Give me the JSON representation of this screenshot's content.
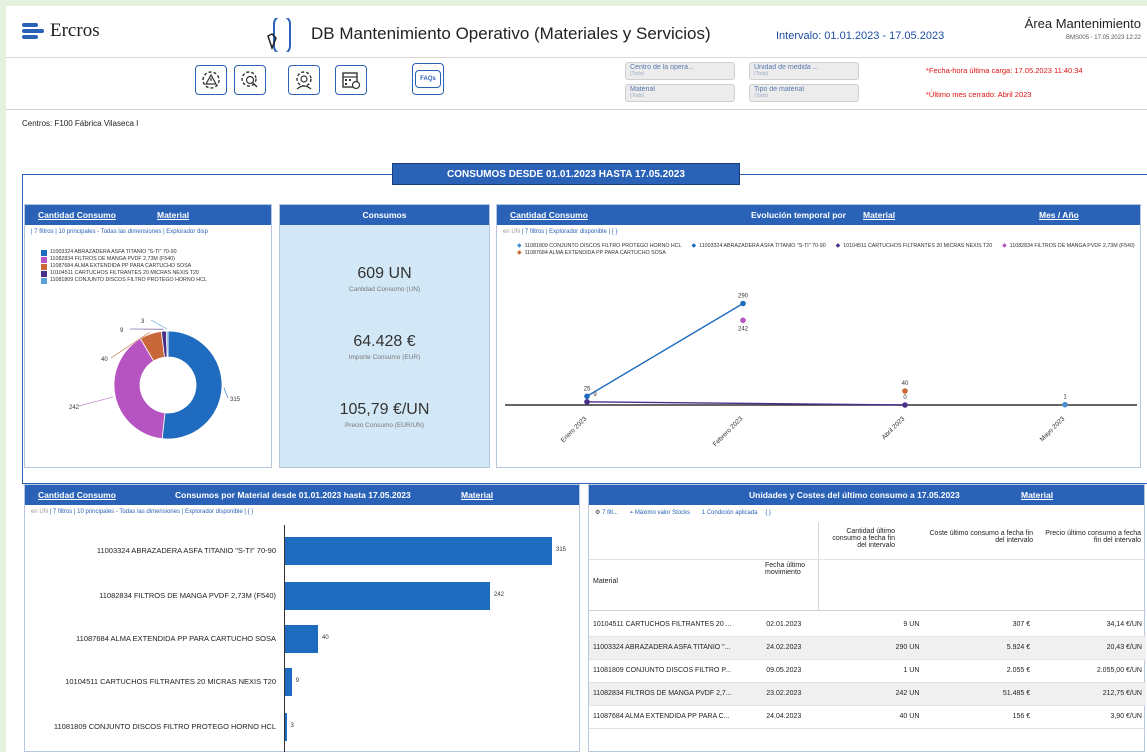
{
  "header": {
    "logo_text": "Ercros",
    "title": "DB Mantenimiento Operativo (Materiales y Servicios)",
    "interval": "Intervalo: 01.01.2023 - 17.05.2023",
    "area_title": "Área Mantenimiento",
    "area_sub": "BMS005 ⋅ 17.05.2023 12:22"
  },
  "toolbar": {
    "buttons": [
      "settings-alert-icon",
      "settings-search-icon",
      "time-gear-icon",
      "calendar-gear-icon"
    ],
    "faq_label": "FAQs"
  },
  "filters": [
    {
      "label": "Centro de la opera...",
      "value": "(Todo)"
    },
    {
      "label": "Unidad de medida ...",
      "value": "(Todo)"
    },
    {
      "label": "Material",
      "value": "(Todo)"
    },
    {
      "label": "Tipo de material",
      "value": "(Todo)"
    }
  ],
  "notes": {
    "last_load": "*Fecha-hora última carga: 17.05.2023 11:40:34",
    "last_month": "*Último mes cerrado:  Abril 2023"
  },
  "centers": "Centros: F100 Fábrica Vilaseca I",
  "banner": "CONSUMOS DESDE 01.01.2023 HASTA 17.05.2023",
  "donut_card": {
    "head_left": "Cantidad Consumo",
    "head_right": "Material",
    "subbar": "| 7 filtros | 10 principales - Todas las dimensiones | Explorador disp",
    "chart_data": {
      "type": "pie",
      "slices": [
        {
          "name": "11003324 ABRAZADERA ASFA TITANIO \"S-TI\" 70-90",
          "value": 315,
          "color": "#1f6bbf"
        },
        {
          "name": "11082834 FILTROS DE MANGA PVDF 2,73M (F540)",
          "value": 242,
          "color": "#b655c2"
        },
        {
          "name": "11087684 ALMA EXTENDIDA PP PARA CARTUCHO SOSA",
          "value": 40,
          "color": "#c8683a"
        },
        {
          "name": "10104511 CARTUCHOS FILTRANTES 20 MICRAS NEXIS T20",
          "value": 9,
          "color": "#4a2f8a"
        },
        {
          "name": "11081809 CONJUNTO DISCOS FILTRO PROTEGO HORNO HCL",
          "value": 3,
          "color": "#5aa0d8"
        }
      ],
      "labels": [
        "315",
        "242",
        "40",
        "9",
        "3"
      ]
    }
  },
  "kpi_card": {
    "head": "Consumos",
    "items": [
      {
        "value": "609 UN",
        "label": "Cantidad Consumo (UN)"
      },
      {
        "value": "64.428 €",
        "label": "Importe Consumo (EUR)"
      },
      {
        "value": "105,79 €/UN",
        "label": "Precio Consumo (EUR/UN)"
      }
    ]
  },
  "line_card": {
    "head_left": "Cantidad Consumo",
    "head_mid": "Evolución temporal por",
    "head_mid_link": "Material",
    "head_right": "Mes / Año",
    "subbar_grey": "en UN",
    "subbar": "| 7 filtros | Explorador disponible | { }",
    "chart_data": {
      "type": "line",
      "categories": [
        "Enero 2023",
        "Febrero 2023",
        "Abril 2023",
        "Mayo 2023"
      ],
      "series": [
        {
          "name": "11081809 CONJUNTO DISCOS FILTRO PROTEGO HORNO HCL",
          "color": "#4a8fd0",
          "values": [
            null,
            null,
            null,
            1
          ]
        },
        {
          "name": "11003324 ABRAZADERA ASFA TITANIO \"S-TI\" 70-90",
          "color": "#1f6bbf",
          "values": [
            25,
            290,
            null,
            null
          ]
        },
        {
          "name": "10104511 CARTUCHOS FILTRANTES 20 MICRAS NEXIS T20",
          "color": "#4a2f8a",
          "values": [
            9,
            null,
            0,
            null
          ]
        },
        {
          "name": "11082834 FILTROS DE MANGA PVDF 2,73M (F540)",
          "color": "#b655c2",
          "values": [
            null,
            242,
            null,
            null
          ]
        },
        {
          "name": "11087684 ALMA EXTENDIDA PP PARA CARTUCHO SOSA",
          "color": "#c8683a",
          "values": [
            null,
            null,
            40,
            null
          ]
        }
      ],
      "ylim": [
        0,
        320
      ]
    }
  },
  "bar_card": {
    "head_left": "Cantidad Consumo",
    "head_mid": "Consumos por Material desde 01.01.2023 hasta 17.05.2023",
    "head_right": "Material",
    "subbar_grey": "en UN",
    "subbar": "| 7 filtros | 10 principales - Todas las dimensiones | Explorador disponible | { }",
    "chart_data": {
      "type": "bar",
      "categories": [
        "11003324 ABRAZADERA ASFA TITANIO \"S-TI\" 70-90",
        "11082834 FILTROS DE MANGA PVDF 2,73M (F540)",
        "11087684 ALMA EXTENDIDA PP PARA CARTUCHO SOSA",
        "10104511 CARTUCHOS FILTRANTES 20 MICRAS NEXIS T20",
        "11081809 CONJUNTO DISCOS FILTRO PROTEGO HORNO HCL"
      ],
      "values": [
        315,
        242,
        40,
        9,
        3
      ],
      "color": "#1f6bbf"
    }
  },
  "table_card": {
    "head": "Unidades y Costes del último consumo a 17.05.2023",
    "head_right": "Material",
    "subbar": "7 filt...",
    "subbar2": "Máximo valor Stocks",
    "subbar3": "1 Condición aplicada",
    "subbar4": "{ }",
    "col_qty": "Cantidad último consumo a fecha fin del intervalo",
    "col_cost": "Coste último consumo a fecha fin del intervalo",
    "col_price": "Precio último consumo a fecha fin del intervalo",
    "col_material": "Material",
    "col_date": "Fecha último movimiento",
    "rows": [
      {
        "material": "10104511 CARTUCHOS FILTRANTES 20 ...",
        "date": "02.01.2023",
        "qty": "9 UN",
        "cost": "307 €",
        "price": "34,14 €/UN"
      },
      {
        "material": "11003324 ABRAZADERA ASFA TITANIO \"...",
        "date": "24.02.2023",
        "qty": "290 UN",
        "cost": "5.924 €",
        "price": "20,43 €/UN"
      },
      {
        "material": "11081809 CONJUNTO DISCOS FILTRO P...",
        "date": "09.05.2023",
        "qty": "1 UN",
        "cost": "2.055 €",
        "price": "2.055,00 €/UN"
      },
      {
        "material": "11082834 FILTROS DE MANGA PVDF 2,7...",
        "date": "23.02.2023",
        "qty": "242 UN",
        "cost": "51.485 €",
        "price": "212,75 €/UN"
      },
      {
        "material": "11087684 ALMA EXTENDIDA PP PARA C...",
        "date": "24.04.2023",
        "qty": "40 UN",
        "cost": "156 €",
        "price": "3,90 €/UN"
      }
    ]
  }
}
